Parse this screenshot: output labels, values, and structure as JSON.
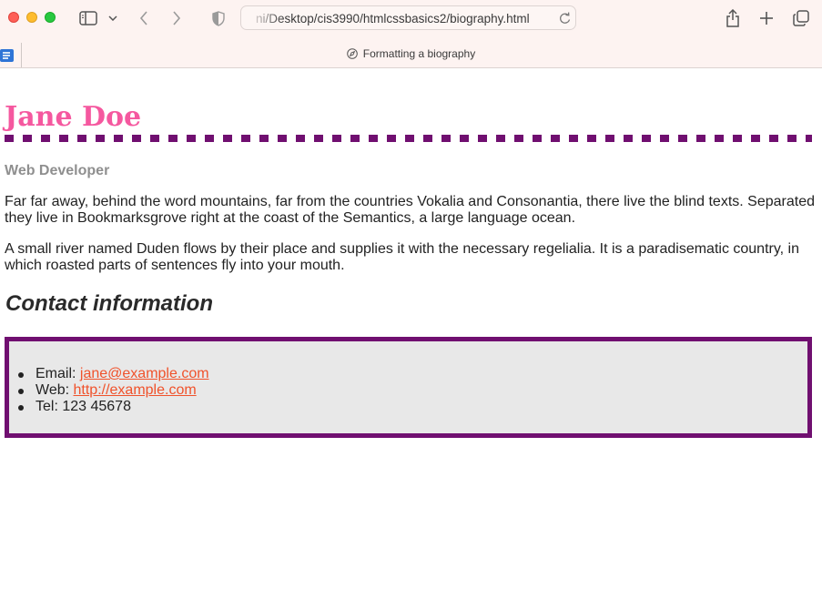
{
  "browser": {
    "url": "ni/Desktop/cis3990/htmlcssbasics2/biography.html",
    "tab_title": "Formatting a biography"
  },
  "page": {
    "name": "Jane Doe",
    "role": "Web Developer",
    "paragraphs": [
      "Far far away, behind the word mountains, far from the countries Vokalia and Consonantia, there live the blind texts. Separated they live in Bookmarksgrove right at the coast of the Semantics, a large language ocean.",
      "A small river named Duden flows by their place and supplies it with the necessary regelialia. It is a paradisematic country, in which roasted parts of sentences fly into your mouth."
    ],
    "contact_heading": "Contact information",
    "contact": {
      "email_label": "Email: ",
      "email": "jane@example.com",
      "web_label": "Web: ",
      "web": "http://example.com",
      "tel": "Tel: 123 45678"
    }
  },
  "colors": {
    "name": "#f5589f",
    "accent": "#700f70",
    "role": "#8f8f8f",
    "link": "#f0522b",
    "box_bg": "#e8e8e8"
  }
}
